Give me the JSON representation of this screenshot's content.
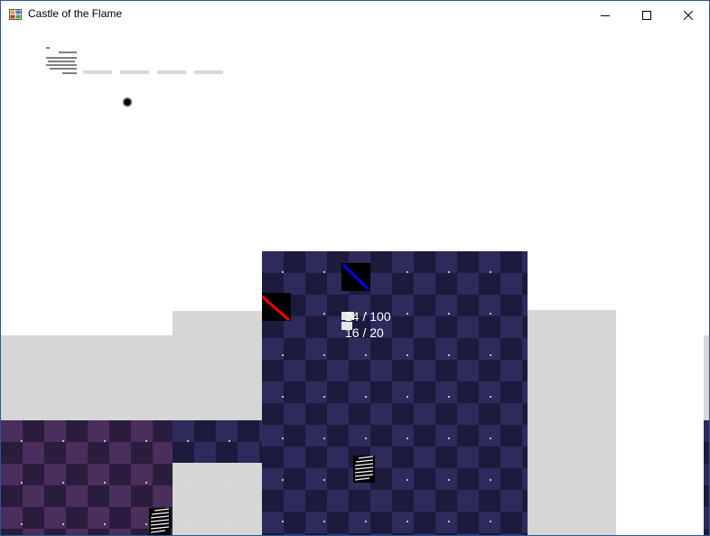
{
  "window": {
    "title": "Castle of the Flame"
  },
  "controls": {
    "minimize_icon": "minimize-icon",
    "maximize_icon": "maximize-icon",
    "close_icon": "close-icon"
  },
  "hud": {
    "bar_count": 4
  },
  "player": {
    "hp_text": "24 / 100",
    "mp_text": "16 / 20"
  },
  "colors": {
    "floor_blue": "#2e2b5c",
    "floor_purple": "#4a2e5c",
    "wall": "#d6d6d6",
    "marker_blue": "#0000ff",
    "marker_red": "#ff0000"
  }
}
